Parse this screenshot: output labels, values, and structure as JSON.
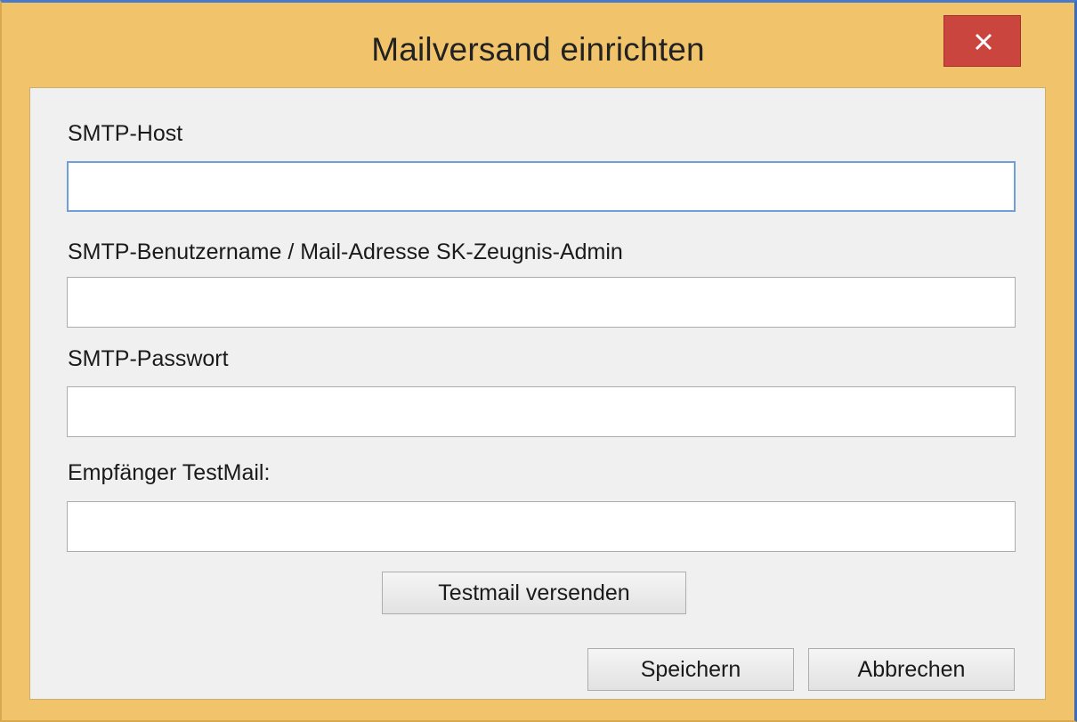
{
  "window": {
    "title": "Mailversand einrichten"
  },
  "form": {
    "smtp_host": {
      "label": "SMTP-Host",
      "value": ""
    },
    "smtp_user": {
      "label": "SMTP-Benutzername / Mail-Adresse SK-Zeugnis-Admin",
      "value": ""
    },
    "smtp_password": {
      "label": "SMTP-Passwort",
      "value": ""
    },
    "test_recipient": {
      "label": "Empfänger TestMail:",
      "value": ""
    }
  },
  "buttons": {
    "send_test": "Testmail versenden",
    "save": "Speichern",
    "cancel": "Abbrechen"
  },
  "icons": {
    "close": "close-icon"
  },
  "colors": {
    "window_frame": "#f1c46b",
    "close_button": "#c9453e",
    "client_background": "#f0f0f0",
    "focus_border": "#6e9fd9"
  }
}
